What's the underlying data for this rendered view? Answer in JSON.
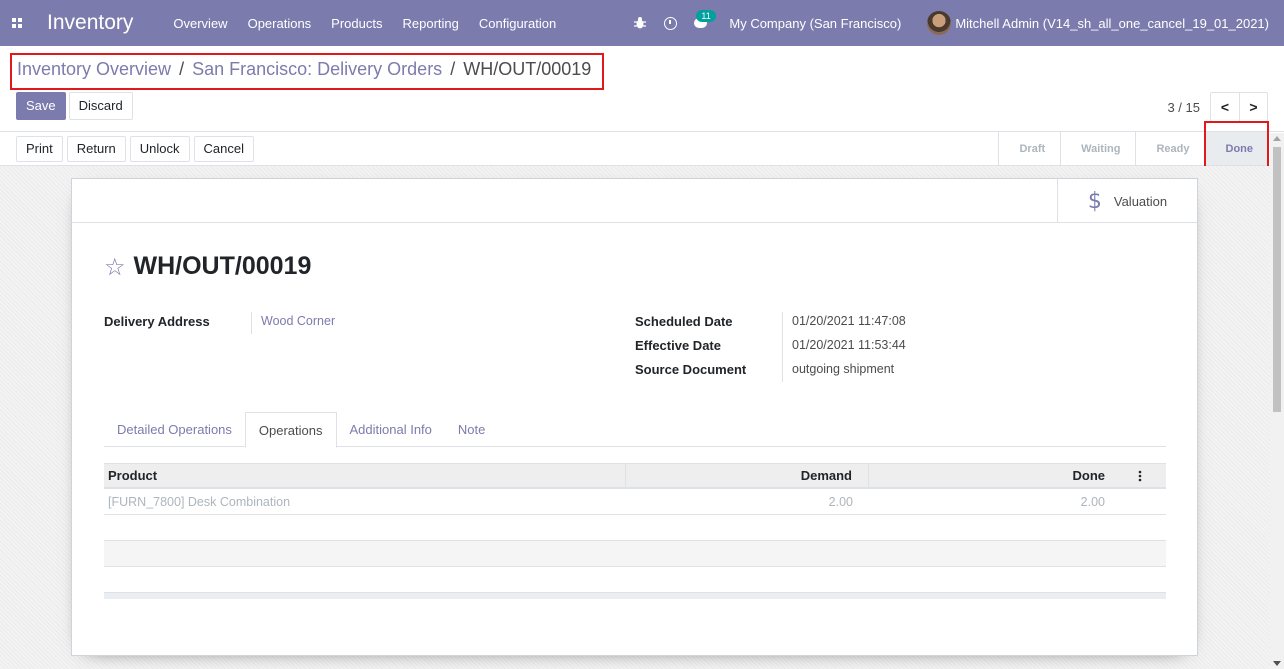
{
  "navbar": {
    "app_title": "Inventory",
    "menu": [
      "Overview",
      "Operations",
      "Products",
      "Reporting",
      "Configuration"
    ],
    "chat_count": "11",
    "company": "My Company (San Francisco)",
    "user": "Mitchell Admin (V14_sh_all_one_cancel_19_01_2021)"
  },
  "breadcrumb": {
    "items": [
      "Inventory Overview",
      "San Francisco: Delivery Orders"
    ],
    "current": "WH/OUT/00019",
    "separator": "/"
  },
  "toolbar": {
    "save_label": "Save",
    "discard_label": "Discard"
  },
  "pager": {
    "value": "3 / 15",
    "prev": "<",
    "next": ">"
  },
  "actions": [
    "Print",
    "Return",
    "Unlock",
    "Cancel"
  ],
  "stages": [
    "Draft",
    "Waiting",
    "Ready",
    "Done"
  ],
  "active_stage": "Done",
  "smart_button": {
    "label": "Valuation",
    "icon": "$"
  },
  "record": {
    "star": "☆",
    "name": "WH/OUT/00019",
    "left_fields": [
      {
        "label": "Delivery Address",
        "value": "Wood Corner"
      }
    ],
    "right_fields": [
      {
        "label": "Scheduled Date",
        "value": "01/20/2021 11:47:08"
      },
      {
        "label": "Effective Date",
        "value": "01/20/2021 11:53:44"
      },
      {
        "label": "Source Document",
        "value": "outgoing shipment"
      }
    ]
  },
  "tabs": [
    "Detailed Operations",
    "Operations",
    "Additional Info",
    "Note"
  ],
  "active_tab": "Operations",
  "operations_table": {
    "headers": {
      "product": "Product",
      "demand": "Demand",
      "done": "Done"
    },
    "rows": [
      {
        "product": "[FURN_7800] Desk Combination",
        "demand": "2.00",
        "done": "2.00"
      }
    ]
  },
  "colors": {
    "brand": "#7c7bad",
    "highlight": "#e0191d"
  }
}
